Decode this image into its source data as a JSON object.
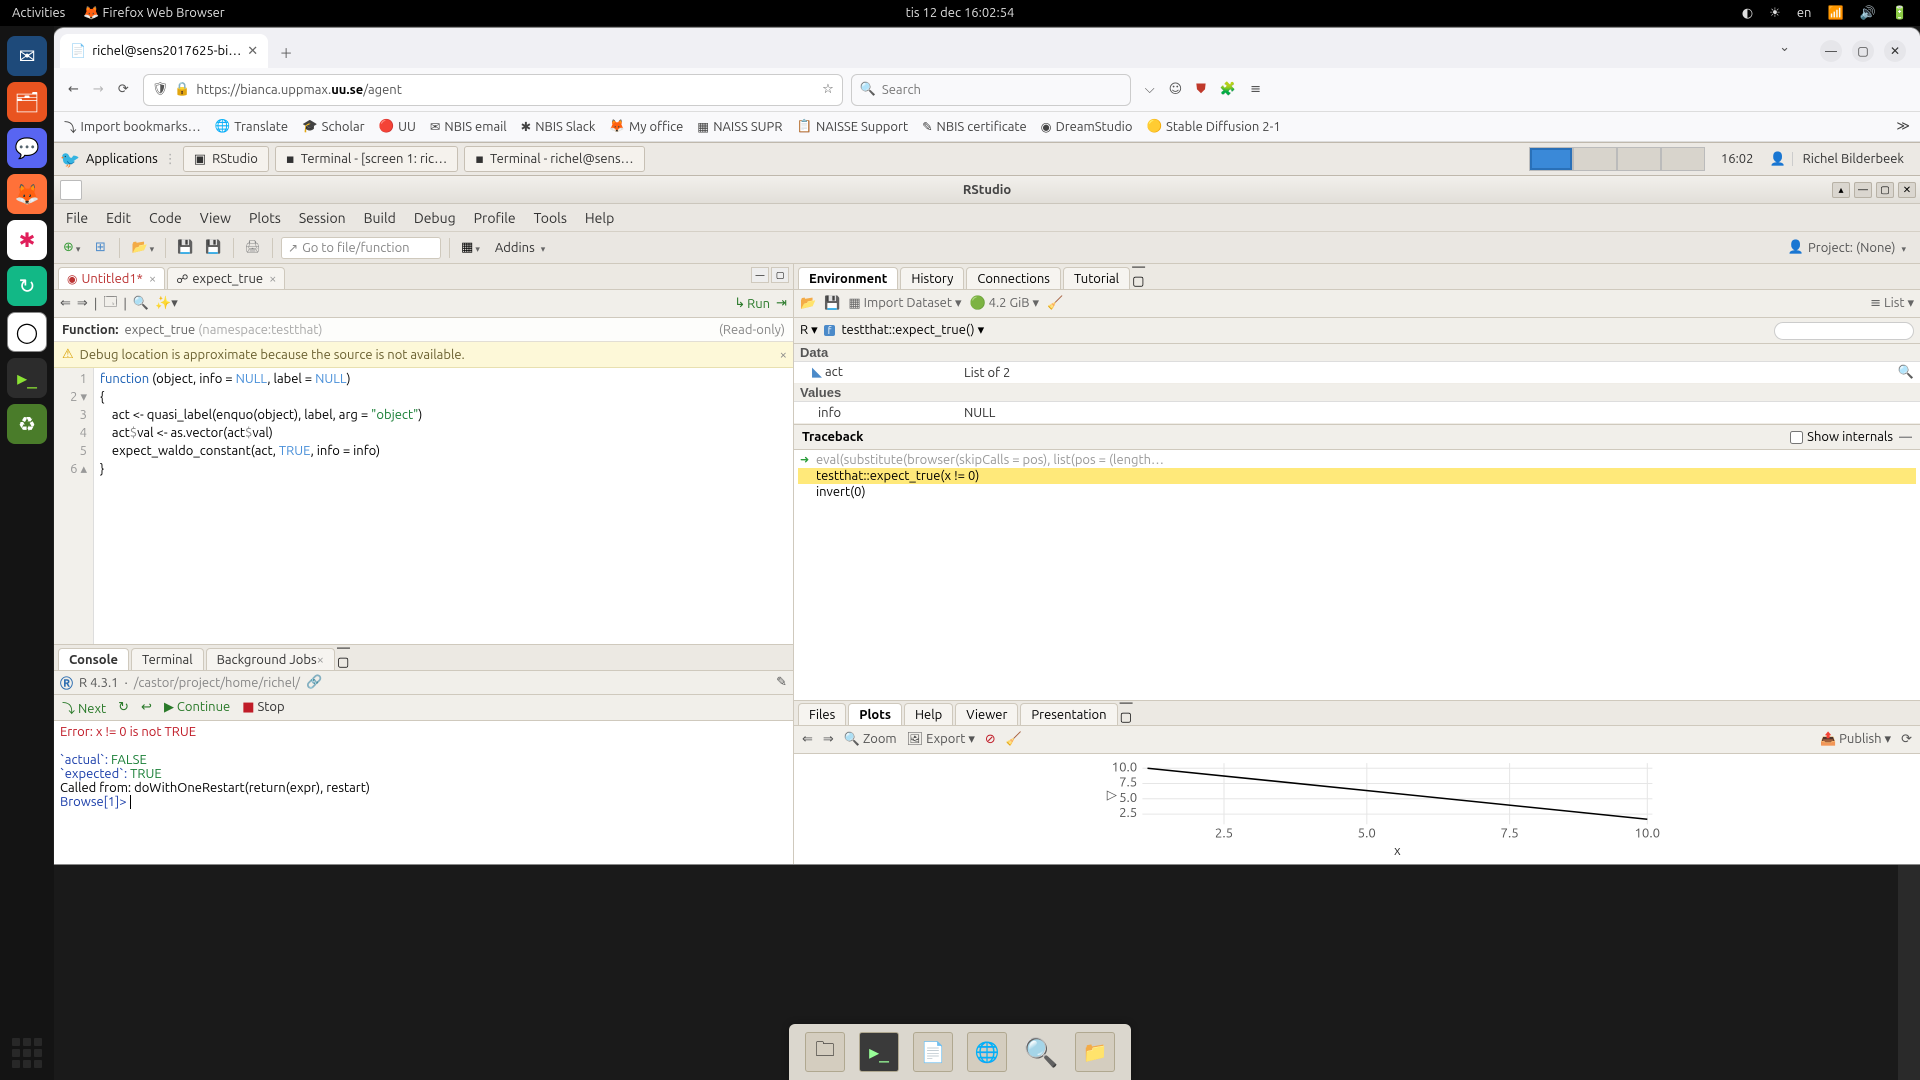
{
  "gnome": {
    "activities": "Activities",
    "app_name": "Firefox Web Browser",
    "datetime": "tis 12 dec  16:02:54",
    "lang": "en"
  },
  "firefox": {
    "tab_title": "richel@sens2017625-bi…",
    "url_display": "https://bianca.uppmax.uu.se/agent",
    "url_bold": "uu.se",
    "search_placeholder": "Search",
    "bookmarks": [
      "Import bookmarks…",
      "Translate",
      "Scholar",
      "UU",
      "NBIS email",
      "NBIS Slack",
      "My office",
      "NAISS SUPR",
      "NAISSE Support",
      "NBIS certificate",
      "DreamStudio",
      "Stable Diffusion 2-1"
    ]
  },
  "remote_bar": {
    "apps_btn": "Applications",
    "tasks": [
      "RStudio",
      "Terminal - [screen 1: ric…",
      "Terminal - richel@sens…"
    ],
    "clock": "16:02",
    "user": "Richel Bilderbeek"
  },
  "rstudio": {
    "title": "RStudio",
    "menus": [
      "File",
      "Edit",
      "Code",
      "View",
      "Plots",
      "Session",
      "Build",
      "Debug",
      "Profile",
      "Tools",
      "Help"
    ],
    "goto_placeholder": "Go to file/function",
    "addins": "Addins",
    "project": "Project: (None)",
    "source": {
      "tabs": [
        {
          "label": "Untitled1*",
          "active": true
        },
        {
          "label": "expect_true",
          "active": false
        }
      ],
      "run": "Run",
      "func_label": "Function:",
      "func_name": "expect_true",
      "func_ns": "(namespace:testthat)",
      "readonly": "(Read-only)",
      "debug_warn": "Debug location is approximate because the source is not available.",
      "code_lines": [
        "1",
        "2",
        "3",
        "4",
        "5",
        "6"
      ]
    },
    "console": {
      "tabs": [
        "Console",
        "Terminal",
        "Background Jobs"
      ],
      "version": "R 4.3.1",
      "path": "/castor/project/home/richel/",
      "debug_btns": {
        "next": "Next",
        "continue": "Continue",
        "stop": "Stop"
      },
      "lines": {
        "err": "Error: x != 0 is not TRUE",
        "actual_lbl": "`actual`:   ",
        "actual_val": "FALSE",
        "expected_lbl": "`expected`: ",
        "expected_val": "TRUE",
        "called": "Called from: doWithOneRestart(return(expr), restart)",
        "prompt": "Browse[1]>"
      }
    },
    "env": {
      "tabs": [
        "Environment",
        "History",
        "Connections",
        "Tutorial"
      ],
      "import": "Import Dataset",
      "mem": "4.2 GiB",
      "mode": "List",
      "scope_fn": "testthat::expect_true()",
      "data_label": "Data",
      "vals_label": "Values",
      "rows": [
        {
          "name": "act",
          "value": "List of  2",
          "expand": true
        },
        {
          "name": "info",
          "value": "NULL",
          "expand": false
        }
      ]
    },
    "traceback": {
      "title": "Traceback",
      "show_internals": "Show internals",
      "lines": [
        {
          "text": "eval(substitute(browser(skipCalls = pos), list(pos = (length…",
          "gray": true,
          "arrow": true
        },
        {
          "text": "testthat::expect_true(x != 0)",
          "hl": true
        },
        {
          "text": "invert(0)"
        }
      ]
    },
    "plots": {
      "tabs": [
        "Files",
        "Plots",
        "Help",
        "Viewer",
        "Presentation"
      ],
      "zoom": "Zoom",
      "export": "Export",
      "publish": "Publish",
      "xlabel": "x"
    }
  },
  "chart_data": {
    "type": "line",
    "x": [
      1,
      2,
      3,
      4,
      5,
      6,
      7,
      8,
      9,
      10
    ],
    "y": [
      10,
      9,
      8,
      7,
      6,
      5,
      4,
      3,
      2,
      1
    ],
    "xlabel": "x",
    "ylabel": "",
    "xlim": [
      1,
      10
    ],
    "ylim": [
      1,
      10
    ],
    "xticks": [
      2.5,
      5.0,
      7.5,
      10.0
    ],
    "yticks": [
      2.5,
      5.0,
      7.5,
      10.0
    ]
  }
}
